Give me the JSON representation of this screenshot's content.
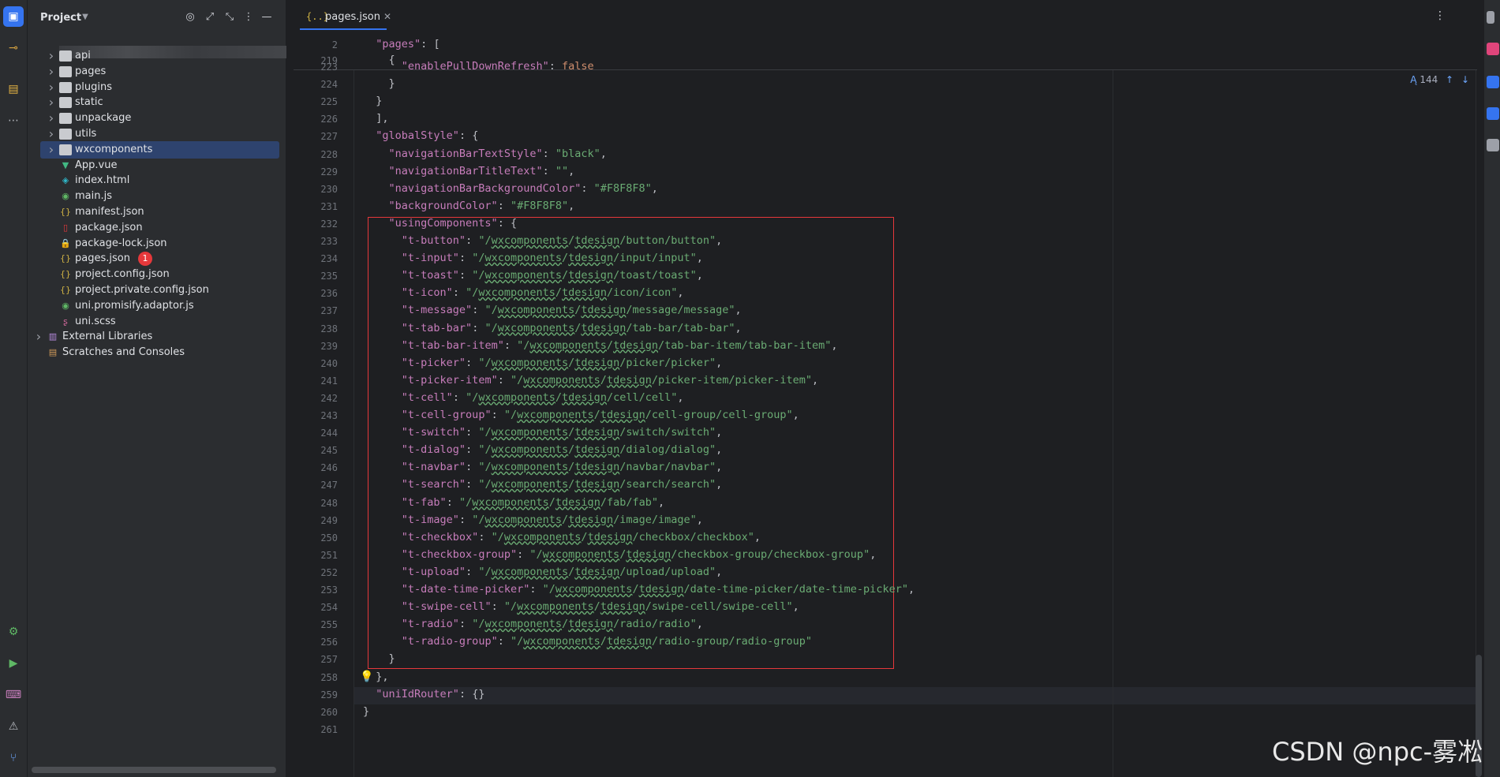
{
  "project_panel": {
    "title": "Project",
    "tree": [
      {
        "label": "api",
        "kind": "folder",
        "icon": "folder-icon"
      },
      {
        "label": "pages",
        "kind": "folder",
        "icon": "folder-icon"
      },
      {
        "label": "plugins",
        "kind": "folder",
        "icon": "folder-icon"
      },
      {
        "label": "static",
        "kind": "folder",
        "icon": "folder-icon"
      },
      {
        "label": "unpackage",
        "kind": "folder",
        "icon": "folder-icon"
      },
      {
        "label": "utils",
        "kind": "folder",
        "icon": "folder-icon"
      },
      {
        "label": "wxcomponents",
        "kind": "folder",
        "icon": "folder-icon",
        "selected": true
      },
      {
        "label": "App.vue",
        "kind": "file",
        "icon": "vue-icon"
      },
      {
        "label": "index.html",
        "kind": "file",
        "icon": "html-icon"
      },
      {
        "label": "main.js",
        "kind": "file",
        "icon": "js-icon"
      },
      {
        "label": "manifest.json",
        "kind": "file",
        "icon": "json-icon"
      },
      {
        "label": "package.json",
        "kind": "file",
        "icon": "npm-icon"
      },
      {
        "label": "package-lock.json",
        "kind": "file",
        "icon": "lock-icon"
      },
      {
        "label": "pages.json",
        "kind": "file",
        "icon": "json-icon",
        "badge": "1"
      },
      {
        "label": "project.config.json",
        "kind": "file",
        "icon": "json-icon"
      },
      {
        "label": "project.private.config.json",
        "kind": "file",
        "icon": "json-icon"
      },
      {
        "label": "uni.promisify.adaptor.js",
        "kind": "file",
        "icon": "js-icon"
      },
      {
        "label": "uni.scss",
        "kind": "file",
        "icon": "sass-icon"
      },
      {
        "label": "External Libraries",
        "kind": "root",
        "icon": "library-icon"
      },
      {
        "label": "Scratches and Consoles",
        "kind": "root",
        "icon": "scratch-icon"
      }
    ]
  },
  "editor": {
    "tab_label": "pages.json",
    "tab_icon_glyph": "{..}",
    "problems_count": "144",
    "sticky": [
      {
        "ln": "2",
        "text": "  \"pages\": ["
      },
      {
        "ln": "219",
        "text": "    {"
      }
    ],
    "lines": [
      {
        "ln": "223",
        "text": "      \"enablePullDownRefresh\": false"
      },
      {
        "ln": "224",
        "text": "    }"
      },
      {
        "ln": "225",
        "text": "  }"
      },
      {
        "ln": "226",
        "text": "  ],"
      },
      {
        "ln": "227",
        "text": "  \"globalStyle\": {"
      },
      {
        "ln": "228",
        "text": "    \"navigationBarTextStyle\": \"black\","
      },
      {
        "ln": "229",
        "text": "    \"navigationBarTitleText\": \"\","
      },
      {
        "ln": "230",
        "text": "    \"navigationBarBackgroundColor\": \"#F8F8F8\","
      },
      {
        "ln": "231",
        "text": "    \"backgroundColor\": \"#F8F8F8\","
      },
      {
        "ln": "232",
        "text": "    \"usingComponents\": {"
      },
      {
        "ln": "233",
        "text": "      \"t-button\": \"/wxcomponents/tdesign/button/button\","
      },
      {
        "ln": "234",
        "text": "      \"t-input\": \"/wxcomponents/tdesign/input/input\","
      },
      {
        "ln": "235",
        "text": "      \"t-toast\": \"/wxcomponents/tdesign/toast/toast\","
      },
      {
        "ln": "236",
        "text": "      \"t-icon\": \"/wxcomponents/tdesign/icon/icon\","
      },
      {
        "ln": "237",
        "text": "      \"t-message\": \"/wxcomponents/tdesign/message/message\","
      },
      {
        "ln": "238",
        "text": "      \"t-tab-bar\": \"/wxcomponents/tdesign/tab-bar/tab-bar\","
      },
      {
        "ln": "239",
        "text": "      \"t-tab-bar-item\": \"/wxcomponents/tdesign/tab-bar-item/tab-bar-item\","
      },
      {
        "ln": "240",
        "text": "      \"t-picker\": \"/wxcomponents/tdesign/picker/picker\","
      },
      {
        "ln": "241",
        "text": "      \"t-picker-item\": \"/wxcomponents/tdesign/picker-item/picker-item\","
      },
      {
        "ln": "242",
        "text": "      \"t-cell\": \"/wxcomponents/tdesign/cell/cell\","
      },
      {
        "ln": "243",
        "text": "      \"t-cell-group\": \"/wxcomponents/tdesign/cell-group/cell-group\","
      },
      {
        "ln": "244",
        "text": "      \"t-switch\": \"/wxcomponents/tdesign/switch/switch\","
      },
      {
        "ln": "245",
        "text": "      \"t-dialog\": \"/wxcomponents/tdesign/dialog/dialog\","
      },
      {
        "ln": "246",
        "text": "      \"t-navbar\": \"/wxcomponents/tdesign/navbar/navbar\","
      },
      {
        "ln": "247",
        "text": "      \"t-search\": \"/wxcomponents/tdesign/search/search\","
      },
      {
        "ln": "248",
        "text": "      \"t-fab\": \"/wxcomponents/tdesign/fab/fab\","
      },
      {
        "ln": "249",
        "text": "      \"t-image\": \"/wxcomponents/tdesign/image/image\","
      },
      {
        "ln": "250",
        "text": "      \"t-checkbox\": \"/wxcomponents/tdesign/checkbox/checkbox\","
      },
      {
        "ln": "251",
        "text": "      \"t-checkbox-group\": \"/wxcomponents/tdesign/checkbox-group/checkbox-group\","
      },
      {
        "ln": "252",
        "text": "      \"t-upload\": \"/wxcomponents/tdesign/upload/upload\","
      },
      {
        "ln": "253",
        "text": "      \"t-date-time-picker\": \"/wxcomponents/tdesign/date-time-picker/date-time-picker\","
      },
      {
        "ln": "254",
        "text": "      \"t-swipe-cell\": \"/wxcomponents/tdesign/swipe-cell/swipe-cell\","
      },
      {
        "ln": "255",
        "text": "      \"t-radio\": \"/wxcomponents/tdesign/radio/radio\","
      },
      {
        "ln": "256",
        "text": "      \"t-radio-group\": \"/wxcomponents/tdesign/radio-group/radio-group\""
      },
      {
        "ln": "257",
        "text": "    }"
      },
      {
        "ln": "258",
        "text": "  },"
      },
      {
        "ln": "259",
        "text": "  \"uniIdRouter\": {}"
      },
      {
        "ln": "260",
        "text": "}"
      },
      {
        "ln": "261",
        "text": ""
      }
    ]
  },
  "watermark": "CSDN @npc-雾凇",
  "colors": {
    "accent": "#3574f0",
    "highlight_box": "#e5383b",
    "string": "#6aab73",
    "key": "#c77dbb"
  }
}
